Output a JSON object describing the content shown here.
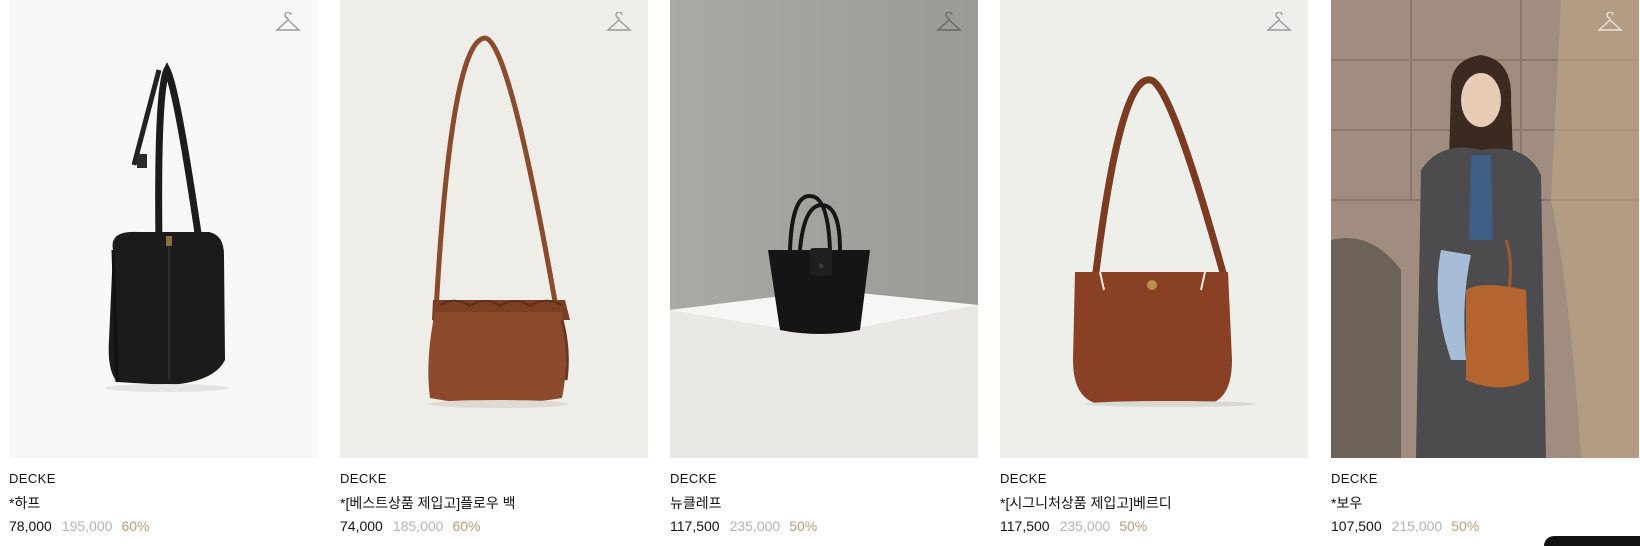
{
  "icons": {
    "wishlist": "hanger-icon"
  },
  "colors": {
    "discount": "#b89b7b",
    "original_price": "#b3b3b3",
    "text": "#111111"
  },
  "products": [
    {
      "brand": "DECKE",
      "name": "*하프",
      "sale_price": "78,000",
      "original_price": "195,000",
      "discount": "60%"
    },
    {
      "brand": "DECKE",
      "name": "*[베스트상품 제입고]플로우 백",
      "sale_price": "74,000",
      "original_price": "185,000",
      "discount": "60%"
    },
    {
      "brand": "DECKE",
      "name": "뉴클레프",
      "sale_price": "117,500",
      "original_price": "235,000",
      "discount": "50%"
    },
    {
      "brand": "DECKE",
      "name": "*[시그니처상품 제입고]베르디",
      "sale_price": "117,500",
      "original_price": "235,000",
      "discount": "50%"
    },
    {
      "brand": "DECKE",
      "name": "*보우",
      "sale_price": "107,500",
      "original_price": "215,000",
      "discount": "50%"
    }
  ]
}
